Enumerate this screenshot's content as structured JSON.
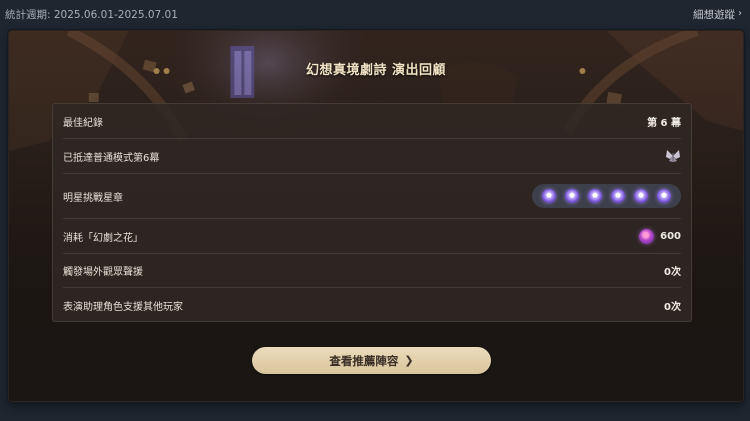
{
  "topbar": {
    "period_text": "統計週期: 2025.06.01-2025.07.01",
    "more_label": "細想遊蹤",
    "more_icon": "chevron-right-icon"
  },
  "card": {
    "title": "幻想真境劇詩 演出回顧",
    "rows": [
      {
        "label": "最佳紀錄",
        "value": "第 6 幕"
      },
      {
        "label": "已抵達普通模式第6幕",
        "value": "",
        "icon": "moth-badge-icon"
      },
      {
        "label": "明星挑戰星章",
        "value": "",
        "stars": 6,
        "star_icon": "star-medal-icon"
      },
      {
        "label": "消耗「幻劇之花」",
        "value": "600",
        "icon": "fantasy-flower-icon"
      },
      {
        "label": "觸發場外觀眾聲援",
        "value": "0次"
      },
      {
        "label": "表演助理角色支援其他玩家",
        "value": "0次"
      }
    ],
    "cta_label": "查看推薦陣容",
    "cta_icon": "chevron-right-icon"
  },
  "colors": {
    "page_bg": "#1f2630",
    "card_bg": "#1b1613",
    "panel_bg": "#302824",
    "title": "#f1e3c4",
    "cta_bg": "#e4d3b0",
    "cta_text": "#3a3025",
    "star": "#7a56d8"
  }
}
